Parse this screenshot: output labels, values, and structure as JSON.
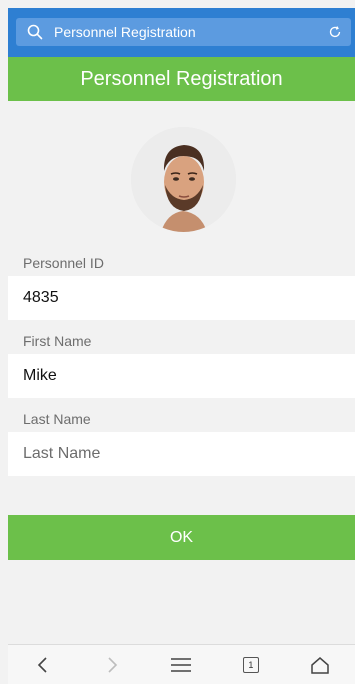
{
  "browser": {
    "search_text": "Personnel Registration"
  },
  "header": {
    "title": "Personnel Registration"
  },
  "form": {
    "personnel_id": {
      "label": "Personnel ID",
      "value": "4835"
    },
    "first_name": {
      "label": "First Name",
      "value": "Mike"
    },
    "last_name": {
      "label": "Last Name",
      "placeholder": "Last Name"
    }
  },
  "actions": {
    "ok_label": "OK"
  },
  "bottom_nav": {
    "tab_count": "1"
  },
  "colors": {
    "browser_blue": "#2e7fd2",
    "accent_green": "#6cc04a"
  }
}
